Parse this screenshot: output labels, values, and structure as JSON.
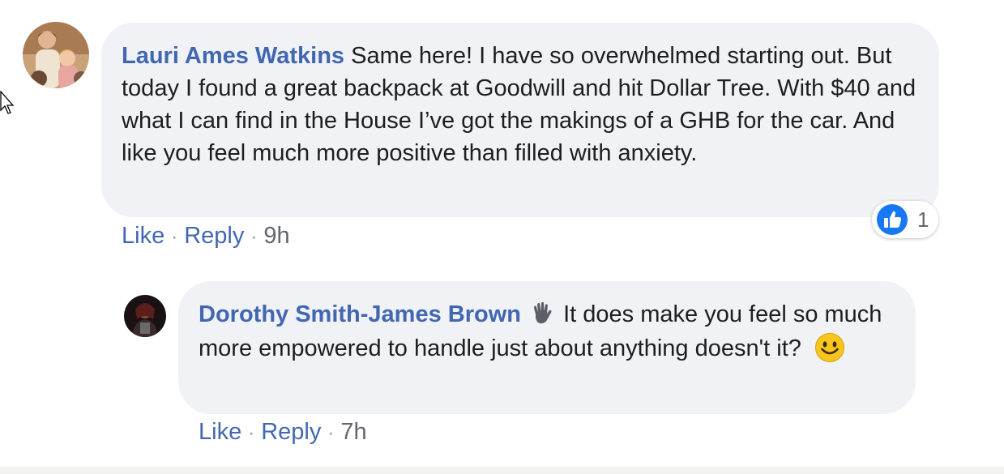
{
  "comments": [
    {
      "author": "Lauri Ames Watkins",
      "text": "Same here! I have so overwhelmed starting out. But today I found a great backpack at Goodwill and hit Dollar Tree. With $40 and what I can find in the House I’ve got the makings of a GHB for the car. And like you feel much more positive than filled with anxiety.",
      "actions": {
        "like": "Like",
        "reply": "Reply",
        "separator": "·",
        "time": "9h"
      },
      "reaction": {
        "icon": "thumbs-up-icon",
        "count": "1",
        "color": "#1877f2"
      }
    },
    {
      "author": "Dorothy Smith-James Brown",
      "author_icon": "waving-hand-icon",
      "text": "It does make you feel so much more empowered to handle just about anything doesn't it?",
      "trailing_icon": "smiling-face-emoji",
      "actions": {
        "like": "Like",
        "reply": "Reply",
        "separator": "·",
        "time": "7h"
      }
    }
  ],
  "colors": {
    "author": "#4267b2",
    "link": "#4267b2",
    "bubble": "#f0f2f5",
    "meta": "#616770"
  }
}
